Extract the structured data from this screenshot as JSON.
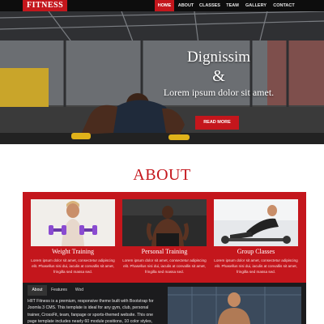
{
  "brand": "FITNESS",
  "nav": {
    "items": [
      {
        "label": "HOME",
        "active": true
      },
      {
        "label": "ABOUT",
        "active": false
      },
      {
        "label": "CLASSES",
        "active": false
      },
      {
        "label": "TEAM",
        "active": false
      },
      {
        "label": "GALLERY",
        "active": false
      },
      {
        "label": "CONTACT",
        "active": false
      }
    ]
  },
  "hero": {
    "line1": "Dignissim",
    "line2": "&",
    "line3": "Lorem ipsum dolor sit amet.",
    "button": "READ MORE"
  },
  "about": {
    "title": "ABOUT",
    "cards": [
      {
        "title": "Weight Training",
        "text": "Lorem ipsum dolor sit amet, consectetur adipiscing elit. Phasellus nisi dui, iaculis at convallis sit amet, fringilla sed massa sed."
      },
      {
        "title": "Personal Training",
        "text": "Lorem ipsum dolor sit amet, consectetur adipiscing elit. Phasellus nisi dui, iaculis at convallis sit amet, fringilla sed massa sed."
      },
      {
        "title": "Group Classes",
        "text": "Lorem ipsum dolor sit amet, consectetur adipiscing elit. Phasellus nisi dui, iaculis at convallis sit amet, fringilla sed massa sed."
      }
    ]
  },
  "tabs": {
    "items": [
      {
        "label": "About",
        "active": true
      },
      {
        "label": "Features",
        "active": false
      },
      {
        "label": "Wod",
        "active": false
      }
    ],
    "content": "HIIT Fitness is a premium, responsive theme built with Bootstrap for Joomla 3 CMS. This template is ideal for any gym, club, personal trainer, CrossFit, team, fanpage or sports-themed website. This one page template includes nearly 60 module positions, 10 color styles,"
  },
  "colors": {
    "accent": "#c4161c",
    "dark": "#0d0d0d",
    "panel": "#1b1b1d"
  }
}
